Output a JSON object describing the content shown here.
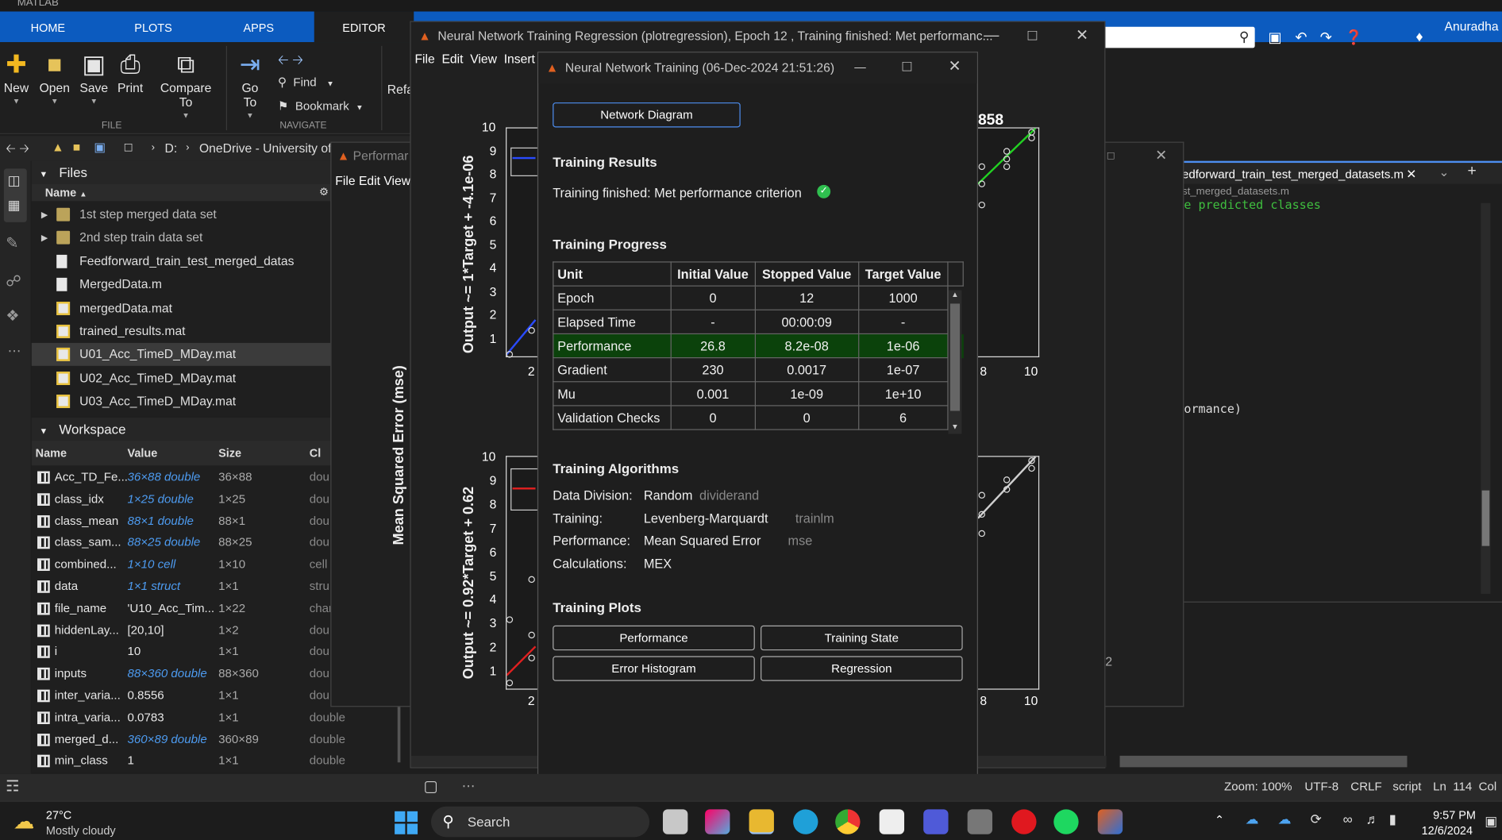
{
  "app": {
    "title": "MATLAB"
  },
  "ribbon": {
    "tabs": [
      {
        "label": "HOME"
      },
      {
        "label": "PLOTS"
      },
      {
        "label": "APPS"
      },
      {
        "label": "EDITOR"
      }
    ],
    "buttons": {
      "new": "New",
      "open": "Open",
      "save": "Save",
      "print": "Print",
      "compare": "Compare To",
      "goto": "Go To",
      "find": "Find",
      "bookmark": "Bookmark",
      "refactor": "Refa"
    },
    "sections": {
      "file": "FILE",
      "navigate": "NAVIGATE"
    },
    "user": "Anuradha"
  },
  "address": {
    "drive": "D:",
    "path": "OneDrive - University of"
  },
  "files": {
    "title": "Files",
    "col_name": "Name",
    "items": [
      {
        "name": "1st step merged data set",
        "kind": "folder"
      },
      {
        "name": "2nd step train data set",
        "kind": "folder"
      },
      {
        "name": "Feedforward_train_test_merged_datas",
        "kind": "m"
      },
      {
        "name": "MergedData.m",
        "kind": "m"
      },
      {
        "name": "mergedData.mat",
        "kind": "mat"
      },
      {
        "name": "trained_results.mat",
        "kind": "mat"
      },
      {
        "name": "U01_Acc_TimeD_MDay.mat",
        "kind": "mat"
      },
      {
        "name": "U02_Acc_TimeD_MDay.mat",
        "kind": "mat"
      },
      {
        "name": "U03_Acc_TimeD_MDay.mat",
        "kind": "mat"
      }
    ]
  },
  "workspace": {
    "title": "Workspace",
    "cols": {
      "name": "Name",
      "value": "Value",
      "size": "Size",
      "class": "Cl"
    },
    "rows": [
      {
        "name": "Acc_TD_Fe...",
        "value": "36×88 double",
        "size": "36×88",
        "cls": "dou"
      },
      {
        "name": "class_idx",
        "value": "1×25 double",
        "size": "1×25",
        "cls": "dou"
      },
      {
        "name": "class_mean",
        "value": "88×1 double",
        "size": "88×1",
        "cls": "dou"
      },
      {
        "name": "class_sam...",
        "value": "88×25 double",
        "size": "88×25",
        "cls": "dou"
      },
      {
        "name": "combined...",
        "value": "1×10 cell",
        "size": "1×10",
        "cls": "cell"
      },
      {
        "name": "data",
        "value": "1×1 struct",
        "size": "1×1",
        "cls": "stru"
      },
      {
        "name": "file_name",
        "value": "'U10_Acc_Tim...",
        "size": "1×22",
        "cls": "char"
      },
      {
        "name": "hiddenLay...",
        "value": "[20,10]",
        "size": "1×2",
        "cls": "dou"
      },
      {
        "name": "i",
        "value": "10",
        "size": "1×1",
        "cls": "dou"
      },
      {
        "name": "inputs",
        "value": "88×360 double",
        "size": "88×360",
        "cls": "dou"
      },
      {
        "name": "inter_varia...",
        "value": "0.8556",
        "size": "1×1",
        "cls": "dou"
      },
      {
        "name": "intra_varia...",
        "value": "0.0783",
        "size": "1×1",
        "cls": "double"
      },
      {
        "name": "merged_d...",
        "value": "360×89 double",
        "size": "360×89",
        "cls": "double"
      },
      {
        "name": "min_class",
        "value": "1",
        "size": "1×1",
        "cls": "double"
      }
    ]
  },
  "regression_window": {
    "title": "Neural Network Training Regression (plotregression), Epoch 12 , Training finished: Met performanc...",
    "menu": [
      "File",
      "Edit",
      "View",
      "Insert"
    ],
    "top_ylabel": "Output ~= 1*Target + -4.1e-06",
    "bottom_ylabel": "Output ~= 0.92*Target + 0.62",
    "yticks": [
      "10",
      "9",
      "8",
      "7",
      "6",
      "5",
      "4",
      "3",
      "2",
      "1"
    ],
    "xtick_left": "2",
    "xticks_right": [
      "8",
      "10"
    ],
    "r_value": "858"
  },
  "perf_window": {
    "title": "Performar",
    "menu": [
      "File",
      "Edit",
      "View"
    ],
    "ylabel": "Mean Squared Error  (mse)"
  },
  "training_window": {
    "title": "Neural Network Training (06-Dec-2024 21:51:26)",
    "network_diagram": "Network Diagram",
    "results_title": "Training Results",
    "results_text": "Training finished: Met performance criterion",
    "progress_title": "Training Progress",
    "progress_headers": [
      "Unit",
      "Initial Value",
      "Stopped Value",
      "Target Value"
    ],
    "progress_rows": [
      [
        "Epoch",
        "0",
        "12",
        "1000"
      ],
      [
        "Elapsed Time",
        "-",
        "00:00:09",
        "-"
      ],
      [
        "Performance",
        "26.8",
        "8.2e-08",
        "1e-06"
      ],
      [
        "Gradient",
        "230",
        "0.0017",
        "1e-07"
      ],
      [
        "Mu",
        "0.001",
        "1e-09",
        "1e+10"
      ],
      [
        "Validation Checks",
        "0",
        "0",
        "6"
      ]
    ],
    "algorithms_title": "Training Algorithms",
    "algorithms": [
      {
        "label": "Data Division:",
        "value": "Random",
        "fn": "dividerand"
      },
      {
        "label": "Training:",
        "value": "Levenberg-Marquardt",
        "fn": "trainlm"
      },
      {
        "label": "Performance:",
        "value": "Mean Squared Error",
        "fn": "mse"
      },
      {
        "label": "Calculations:",
        "value": "MEX",
        "fn": ""
      }
    ],
    "plots_title": "Training Plots",
    "plot_buttons": [
      "Performance",
      "Training State",
      "Error Histogram",
      "Regression"
    ]
  },
  "editor": {
    "tab": "edforward_train_test_merged_datasets.m",
    "subpath": "st_merged_datasets.m",
    "line1": "e predicted classes",
    "line2": "ormance)",
    "right_digit": "2"
  },
  "statusbar": {
    "zoom": "Zoom: 100%",
    "encoding": "UTF-8",
    "eol": "CRLF",
    "type": "script",
    "pos": "Ln  114  Col"
  },
  "taskbar": {
    "temp": "27°C",
    "weather": "Mostly cloudy",
    "search": "Search",
    "time": "9:57 PM",
    "date": "12/6/2024"
  }
}
